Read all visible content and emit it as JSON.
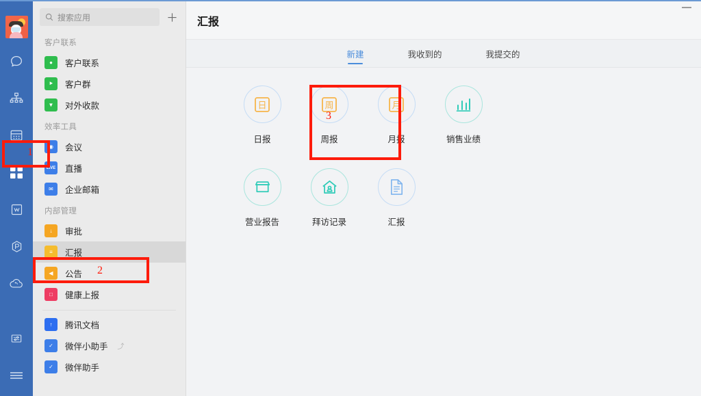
{
  "window": {
    "minimize_label": "minimize",
    "accent_blue": "#4b8ddb",
    "rail_blue": "#3b6cb5"
  },
  "rail": {
    "avatar_name": "user-avatar",
    "items": [
      {
        "name": "chat-icon",
        "label": "消息",
        "active": false
      },
      {
        "name": "contacts-icon",
        "label": "通讯录",
        "active": false
      },
      {
        "name": "calendar-icon",
        "label": "日程",
        "active": false
      },
      {
        "name": "workbench-grid-icon",
        "label": "工作台",
        "active": true
      },
      {
        "name": "wedoc-icon",
        "label": "文档",
        "active": false
      },
      {
        "name": "wepoll-icon",
        "label": "收集表",
        "active": false
      },
      {
        "name": "drive-icon",
        "label": "微盘",
        "active": false
      }
    ],
    "bottom_items": [
      {
        "name": "settings-sliders-icon",
        "label": "设置"
      },
      {
        "name": "menu-lines-icon",
        "label": "菜单"
      }
    ]
  },
  "search": {
    "placeholder": "搜索应用",
    "icon": "search-icon",
    "add_button_label": "+"
  },
  "applist": {
    "groups": [
      {
        "title": "客户联系",
        "items": [
          {
            "label": "客户联系",
            "icon": "wechat-bubble-icon",
            "color": "#2fbd4e",
            "glyph": "●",
            "selected": false
          },
          {
            "label": "客户群",
            "icon": "group-icon",
            "color": "#2fbd4e",
            "glyph": "⯈",
            "selected": false
          },
          {
            "label": "对外收款",
            "icon": "shield-pay-icon",
            "color": "#2fbd4e",
            "glyph": "▼",
            "selected": false
          }
        ]
      },
      {
        "title": "效率工具",
        "items": [
          {
            "label": "会议",
            "icon": "meeting-camera-icon",
            "color": "#3d7ee8",
            "glyph": "◉",
            "selected": false
          },
          {
            "label": "直播",
            "icon": "live-icon",
            "color": "#3d7ee8",
            "glyph": "LIVE",
            "selected": false
          },
          {
            "label": "企业邮箱",
            "icon": "mail-envelope-icon",
            "color": "#3d7ee8",
            "glyph": "✉",
            "selected": false
          }
        ]
      },
      {
        "title": "内部管理",
        "items": [
          {
            "label": "审批",
            "icon": "approval-stamp-icon",
            "color": "#f5a623",
            "glyph": "↓",
            "selected": false
          },
          {
            "label": "汇报",
            "icon": "report-doc-icon",
            "color": "#f5bc2e",
            "glyph": "≡",
            "selected": true
          },
          {
            "label": "公告",
            "icon": "announcement-megaphone-icon",
            "color": "#f5a623",
            "glyph": "◀",
            "selected": false
          },
          {
            "label": "健康上报",
            "icon": "health-report-icon",
            "color": "#ee3d63",
            "glyph": "□",
            "selected": false
          }
        ]
      },
      {
        "title": "",
        "items": [
          {
            "label": "腾讯文档",
            "icon": "tencent-docs-icon",
            "color": "#2d6ef0",
            "glyph": "↑",
            "selected": false
          },
          {
            "label": "微伴小助手",
            "icon": "weiban-mini-assistant-icon",
            "color": "#3d7ee8",
            "glyph": "✓",
            "selected": false,
            "link_mark": "⤴"
          },
          {
            "label": "微伴助手",
            "icon": "weiban-assistant-icon",
            "color": "#3d7ee8",
            "glyph": "✓",
            "selected": false
          }
        ]
      }
    ]
  },
  "main": {
    "title": "汇报",
    "tabs": [
      {
        "label": "新建",
        "active": true
      },
      {
        "label": "我收到的",
        "active": false
      },
      {
        "label": "我提交的",
        "active": false
      }
    ],
    "cards": [
      [
        {
          "label": "日报",
          "icon": "daily-report-icon",
          "glyph": "日",
          "ring": "#c5dcf5",
          "color": "#f7b54a",
          "style": "boxed-char"
        },
        {
          "label": "周报",
          "icon": "weekly-report-icon",
          "glyph": "周",
          "ring": "#c5dcf5",
          "color": "#f7b54a",
          "style": "boxed-char"
        },
        {
          "label": "月报",
          "icon": "monthly-report-icon",
          "glyph": "月",
          "ring": "#c5dcf5",
          "color": "#f7b54a",
          "style": "boxed-char"
        },
        {
          "label": "销售业绩",
          "icon": "sales-performance-bar-chart-icon",
          "glyph": "",
          "ring": "#a8e5dd",
          "color": "#2fcbb8",
          "style": "bars"
        }
      ],
      [
        {
          "label": "营业报告",
          "icon": "business-report-store-icon",
          "glyph": "",
          "ring": "#a8e5dd",
          "color": "#2fcbb8",
          "style": "store"
        },
        {
          "label": "拜访记录",
          "icon": "visit-record-house-icon",
          "glyph": "",
          "ring": "#a8e5dd",
          "color": "#2fcbb8",
          "style": "house"
        },
        {
          "label": "汇报",
          "icon": "report-document-icon",
          "glyph": "",
          "ring": "#c5dcf5",
          "color": "#7fb4ee",
          "style": "doc"
        }
      ]
    ]
  },
  "annotations": [
    {
      "number": "1",
      "target": "workbench-grid-icon"
    },
    {
      "number": "2",
      "target": "sidebar-item-report"
    },
    {
      "number": "3",
      "target": "card-daily-report"
    }
  ]
}
